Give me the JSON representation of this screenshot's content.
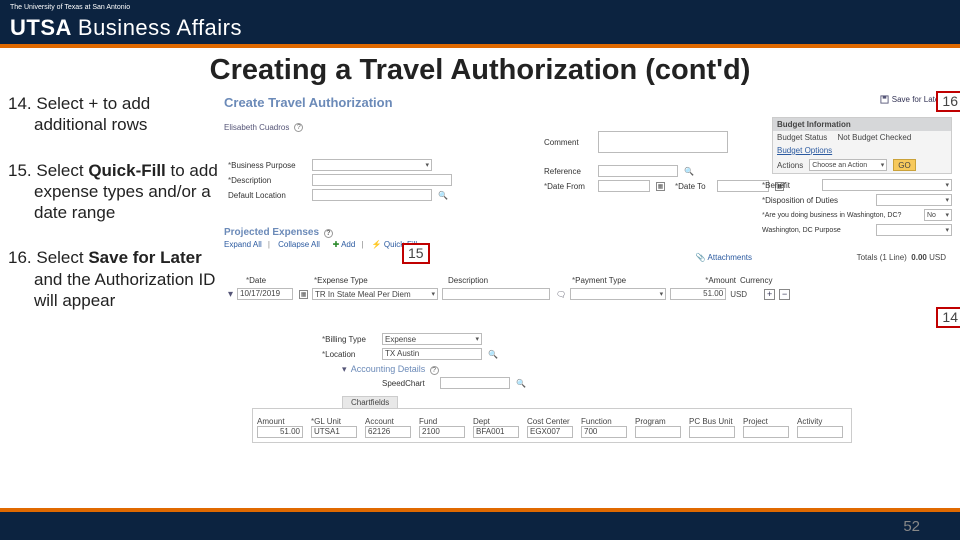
{
  "header": {
    "ut_line": "The University of Texas at San Antonio",
    "mark": "UTSA",
    "unit": "Business Affairs"
  },
  "slide": {
    "title": "Creating a Travel Authorization (cont'd)",
    "page_number": "52"
  },
  "steps": {
    "s14": "14. Select + to add additional rows",
    "s15_pre": "15. Select ",
    "s15_bold": "Quick-Fill",
    "s15_post": " to add expense types and/or a date range",
    "s16_pre": "16. Select ",
    "s16_bold": "Save for Later",
    "s16_post": " and the Authorization ID will appear"
  },
  "callouts": {
    "c14": "14",
    "c15": "15",
    "c16": "16"
  },
  "form": {
    "title": "Create Travel Authorization",
    "save_later": "Save for Later",
    "user": "Elisabeth Cuadros",
    "labels": {
      "business_purpose": "Business Purpose",
      "description": "Description",
      "default_location": "Default Location",
      "comment": "Comment",
      "reference": "Reference",
      "date_from": "Date From",
      "date_to": "Date To",
      "benefit": "Benefit",
      "disposition": "Disposition of Duties",
      "washington_q": "Are you doing business in Washington, DC?",
      "washington_purpose": "Washington, DC Purpose"
    },
    "washington_value": "No",
    "budget": {
      "header": "Budget Information",
      "status_lbl": "Budget Status",
      "status_val": "Not Budget Checked",
      "options": "Budget Options",
      "actions_lbl": "Actions",
      "actions_val": "Choose an Action",
      "go": "GO"
    },
    "projected": {
      "header": "Projected Expenses",
      "expand": "Expand All",
      "collapse": "Collapse All",
      "add": "Add",
      "quickfill": "Quick-Fill",
      "attachments": "Attachments",
      "totals_lbl": "Totals (1 Line)",
      "totals_amt": "0.00",
      "totals_cur": "USD"
    },
    "cols": {
      "date": "Date",
      "expense_type": "Expense Type",
      "description": "Description",
      "payment_type": "Payment Type",
      "amount": "Amount",
      "currency": "Currency",
      "billing_type": "Billing Type",
      "location": "Location"
    },
    "row1": {
      "date": "10/17/2019",
      "expense_type": "TR In State Meal Per Diem",
      "amount": "51.00",
      "currency": "USD",
      "billing_type": "Expense",
      "location": "TX Austin"
    },
    "accounting": {
      "header": "Accounting Details",
      "speedchart": "SpeedChart",
      "tab": "Chartfields",
      "cols": [
        "Amount",
        "GL Unit",
        "Account",
        "Fund",
        "Dept",
        "Cost Center",
        "Function",
        "Program",
        "PC Bus Unit",
        "Project",
        "Activity"
      ],
      "vals": [
        "51.00",
        "UTSA1",
        "62126",
        "2100",
        "BFA001",
        "EGX007",
        "700"
      ]
    }
  }
}
